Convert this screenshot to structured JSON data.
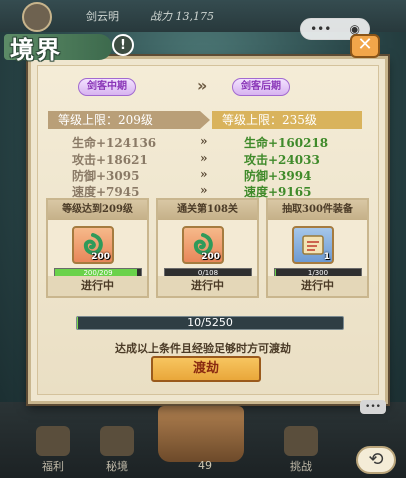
{
  "top_bar": {
    "player_name": "剑云明",
    "power_text": "战力 13,175",
    "menu_pill": {
      "more_label": "•••",
      "record_label": "◉"
    }
  },
  "dialog": {
    "title": "境界",
    "info_label": "!",
    "close_label": "✕",
    "current_stage": "剑客中期",
    "next_stage": "剑客后期",
    "stage_arrow": "»",
    "current_limit": "等级上限：209级",
    "next_limit": "等级上限：235级",
    "stats": [
      {
        "old": "生命+124136",
        "new": "生命+160218"
      },
      {
        "old": "攻击+18621",
        "new": "攻击+24033"
      },
      {
        "old": "防御+3095",
        "new": "防御+3994"
      },
      {
        "old": "速度+7945",
        "new": "速度+9165"
      }
    ],
    "stat_arrow": "»",
    "tasks": [
      {
        "title": "等级达到209级",
        "icon": "green-swirl-icon",
        "count": "200",
        "progress_text": "200/209",
        "progress_fraction": 0.957,
        "status": "进行中"
      },
      {
        "title": "通关第108关",
        "icon": "green-swirl-icon",
        "count": "200",
        "progress_text": "0/108",
        "progress_fraction": 0,
        "status": "进行中"
      },
      {
        "title": "抽取300件装备",
        "icon": "scroll-icon",
        "count": "1",
        "progress_text": "1/300",
        "progress_fraction": 0.003,
        "status": "进行中"
      }
    ],
    "exp_text": "10/5250",
    "exp_fraction": 0.002,
    "hint": "达成以上条件且经验足够时方可渡劫",
    "action_label": "渡劫"
  },
  "bottom_nav": {
    "items": [
      "福利",
      "秘境",
      "挑战"
    ],
    "level": "49"
  },
  "colors": {
    "accent_green": "#3f8a2a",
    "gold": "#e9a73a",
    "stage_purple": "#8a36b8"
  }
}
